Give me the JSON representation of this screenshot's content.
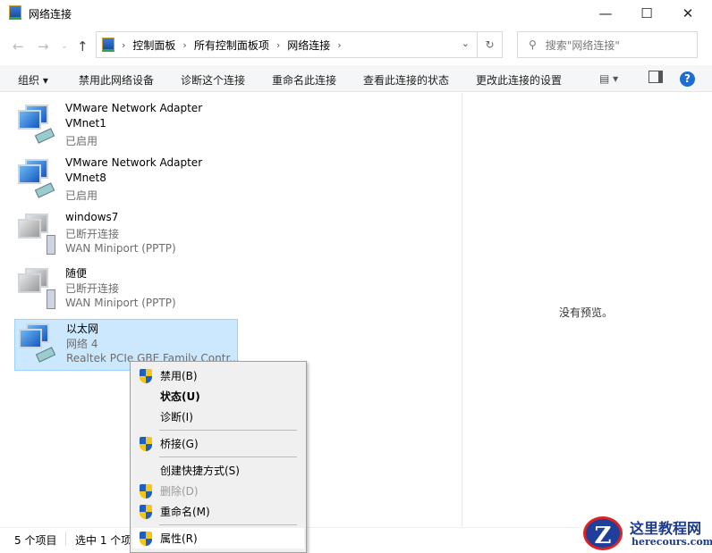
{
  "window": {
    "title": "网络连接"
  },
  "address": {
    "crumbs": [
      "控制面板",
      "所有控制面板项",
      "网络连接"
    ]
  },
  "search": {
    "placeholder": "搜索\"网络连接\""
  },
  "toolbar": {
    "organize": "组织 ▾",
    "disable": "禁用此网络设备",
    "diagnose": "诊断这个连接",
    "rename": "重命名此连接",
    "view_status": "查看此连接的状态",
    "change_settings": "更改此连接的设置"
  },
  "connections": [
    {
      "name": "VMware Network Adapter",
      "line2": "VMnet1",
      "line3": "已启用",
      "type": "adapter"
    },
    {
      "name": "VMware Network Adapter",
      "line2": "VMnet8",
      "line3": "已启用",
      "type": "adapter"
    },
    {
      "name": "windows7",
      "line2": "已断开连接",
      "line3": "WAN Miniport (PPTP)",
      "type": "vpn"
    },
    {
      "name": "随便",
      "line2": "已断开连接",
      "line3": "WAN Miniport (PPTP)",
      "type": "vpn"
    },
    {
      "name": "以太网",
      "line2": "网络 4",
      "line3": "Realtek PCIe GBE Family Contr...",
      "type": "adapter",
      "selected": true
    }
  ],
  "preview": {
    "text": "没有预览。"
  },
  "statusbar": {
    "count": "5 个项目",
    "selected": "选中 1 个项目"
  },
  "context_menu": [
    {
      "label": "禁用(B)",
      "shield": true
    },
    {
      "label": "状态(U)",
      "bold": true
    },
    {
      "label": "诊断(I)"
    },
    {
      "label": "桥接(G)",
      "shield": true
    },
    {
      "label": "创建快捷方式(S)"
    },
    {
      "label": "删除(D)",
      "shield": true,
      "disabled": true
    },
    {
      "label": "重命名(M)",
      "shield": true
    },
    {
      "label": "属性(R)",
      "shield": true,
      "highlighted": true
    }
  ],
  "watermark": {
    "cn": "这里教程网",
    "en": "herecours.com"
  }
}
